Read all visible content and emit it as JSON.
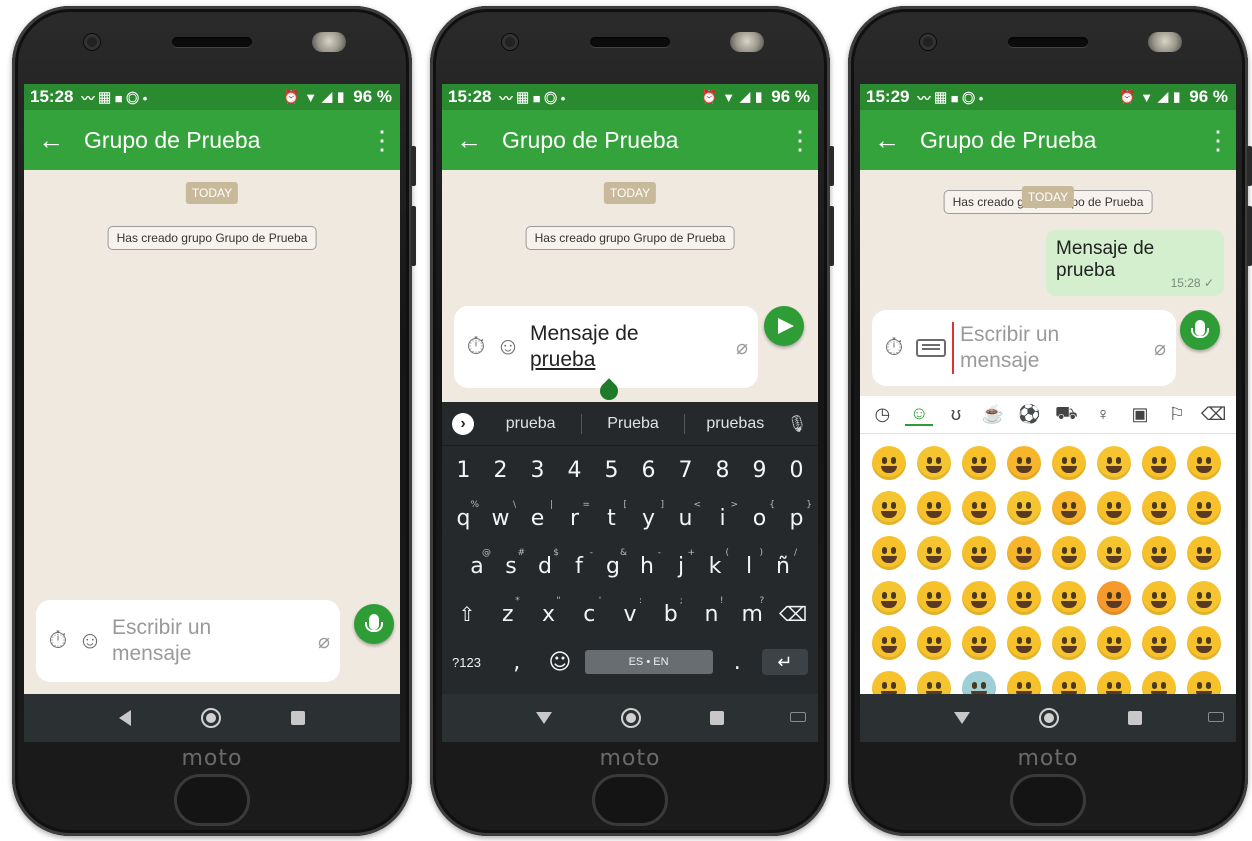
{
  "screens": [
    {
      "status": {
        "time": "15:28",
        "battery": "96 %"
      },
      "toolbar": {
        "back": "←",
        "title": "Grupo de Prueba",
        "more": "⋮"
      },
      "chat": {
        "date_chip": "TODAY",
        "system_message": "Has creado grupo Grupo de Prueba"
      },
      "input": {
        "placeholder_line1": "Escribir un",
        "placeholder_line2": "mensaje"
      }
    },
    {
      "status": {
        "time": "15:28",
        "battery": "96 %"
      },
      "toolbar": {
        "back": "←",
        "title": "Grupo de Prueba",
        "more": "⋮"
      },
      "chat": {
        "date_chip": "TODAY",
        "system_message": "Has creado grupo Grupo de Prueba"
      },
      "input": {
        "typed_line1": "Mensaje de",
        "typed_line2": "prueba"
      },
      "keyboard": {
        "suggestions": [
          "prueba",
          "Prueba",
          "pruebas"
        ],
        "numbers": [
          "1",
          "2",
          "3",
          "4",
          "5",
          "6",
          "7",
          "8",
          "9",
          "0"
        ],
        "row_qwerty": [
          "q",
          "w",
          "e",
          "r",
          "t",
          "y",
          "u",
          "i",
          "o",
          "p"
        ],
        "row_qwerty_alt": [
          "%",
          "\\",
          "|",
          "=",
          "[",
          "]",
          "<",
          ">",
          "{",
          "}"
        ],
        "row_asdf": [
          "a",
          "s",
          "d",
          "f",
          "g",
          "h",
          "j",
          "k",
          "l",
          "ñ"
        ],
        "row_asdf_alt": [
          "@",
          "#",
          "$",
          "-",
          "&",
          "-",
          "+",
          "(",
          ")",
          "/"
        ],
        "row_zxcv": [
          "z",
          "x",
          "c",
          "v",
          "b",
          "n",
          "m"
        ],
        "row_zxcv_alt": [
          "*",
          "\"",
          "'",
          ":",
          ";",
          "!",
          "?"
        ],
        "symbols_label": "?123",
        "comma": ",",
        "space_label": "ES • EN",
        "period": "."
      }
    },
    {
      "status": {
        "time": "15:29",
        "battery": "96 %"
      },
      "toolbar": {
        "back": "←",
        "title": "Grupo de Prueba",
        "more": "⋮"
      },
      "chat": {
        "date_chip": "TODAY",
        "system_message": "Has creado grupo Grupo de Prueba",
        "message_text": "Mensaje de prueba",
        "message_time": "15:28"
      },
      "input": {
        "placeholder_line1": "Escribir un",
        "placeholder_line2": "mensaje"
      },
      "emoji_categories": [
        "recent-icon",
        "smiley-icon",
        "animal-icon",
        "food-icon",
        "sports-icon",
        "car-icon",
        "lightbulb-icon",
        "symbols-icon",
        "flag-icon",
        "backspace-icon"
      ],
      "emoji_colors": [
        "#f7c12b",
        "#f5c431",
        "#f7c12b",
        "#f7b52b",
        "#f7c12b",
        "#f5c431",
        "#f7c12b",
        "#f7c12b",
        "#f5c431",
        "#f7c12b",
        "#f7c12b",
        "#f5c431",
        "#f7b52b",
        "#f7c12b",
        "#f7c12b",
        "#f7c12b",
        "#f7c12b",
        "#f5c431",
        "#f7c12b",
        "#f7b52b",
        "#f7c12b",
        "#f5c431",
        "#f7c12b",
        "#f7c12b",
        "#f5c431",
        "#f7c12b",
        "#f7c12b",
        "#f7c12b",
        "#f7c12b",
        "#f59a2b",
        "#f7c12b",
        "#f5c431",
        "#f7c12b",
        "#f7c12b",
        "#f7c12b",
        "#f7c12b",
        "#f5c431",
        "#f7c12b",
        "#f7c12b",
        "#f7c12b",
        "#f7c12b",
        "#f5c431",
        "#9ecfd6",
        "#f7c12b",
        "#f7c12b",
        "#f7c12b",
        "#f7c12b",
        "#f7c12b"
      ]
    }
  ],
  "brand": "moto"
}
